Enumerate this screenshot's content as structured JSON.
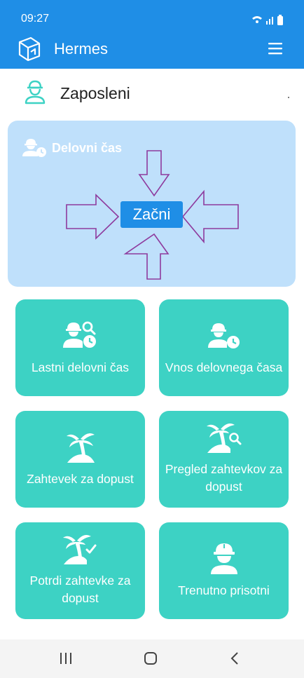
{
  "status_bar": {
    "time": "09:27"
  },
  "app": {
    "title": "Hermes"
  },
  "section": {
    "title": "Zaposleni"
  },
  "work_time_panel": {
    "title": "Delovni čas",
    "start_button": "Začni"
  },
  "tiles": [
    {
      "label": "Lastni delovni čas",
      "icon": "worker-clock-search-icon"
    },
    {
      "label": "Vnos delovnega časa",
      "icon": "worker-clock-icon"
    },
    {
      "label": "Zahtevek za dopust",
      "icon": "palm-island-icon"
    },
    {
      "label": "Pregled zahtevkov za dopust",
      "icon": "palm-island-search-icon"
    },
    {
      "label": "Potrdi zahtevke za dopust",
      "icon": "palm-island-check-icon"
    },
    {
      "label": "Trenutno prisotni",
      "icon": "worker-icon"
    }
  ],
  "colors": {
    "primary": "#1f8ee6",
    "panel": "#bfe0fb",
    "tile": "#3dd2c4",
    "arrow_outline": "#8e3a9d"
  }
}
